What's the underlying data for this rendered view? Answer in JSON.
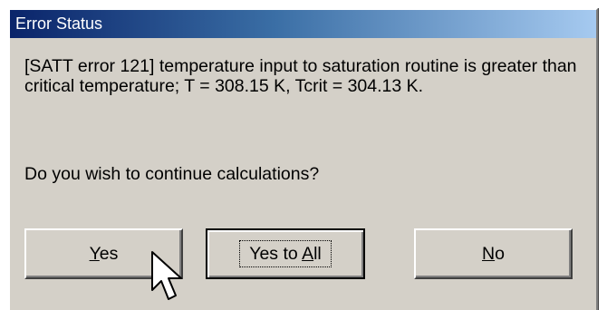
{
  "dialog": {
    "title": "Error Status",
    "message": "[SATT error 121] temperature input to saturation routine is greater than critical temperature; T = 308.15 K, Tcrit = 304.13 K.",
    "question": "Do you wish to continue calculations?",
    "buttons": {
      "yes": {
        "mnemonic": "Y",
        "rest": "es"
      },
      "yes_to_all": {
        "before": "Yes to ",
        "mnemonic": "A",
        "rest": "ll"
      },
      "no": {
        "mnemonic": "N",
        "rest": "o"
      }
    },
    "colors": {
      "titlebar_start": "#0a246a",
      "titlebar_end": "#a6caf0",
      "face": "#d4d0c8"
    }
  },
  "cursor": {
    "icon": "mouse-pointer-icon"
  }
}
